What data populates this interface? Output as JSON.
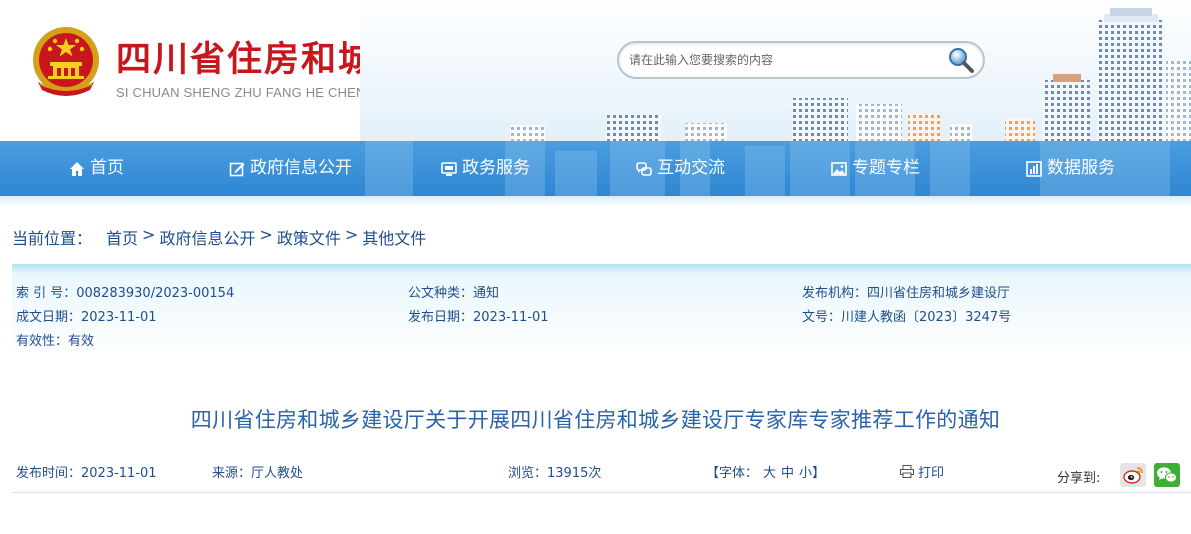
{
  "header": {
    "title": "四川省住房和城乡建设厅",
    "subtitle": "SI CHUAN SHENG ZHU FANG HE CHENG XIANG JIAN SHE TING",
    "emblem_icon": "national-emblem-icon"
  },
  "search": {
    "placeholder": "请在此输入您要搜索的内容",
    "value": "",
    "icon": "search-icon"
  },
  "nav": {
    "items": [
      {
        "label": "首页",
        "icon": "home-icon"
      },
      {
        "label": "政府信息公开",
        "icon": "edit-icon"
      },
      {
        "label": "政务服务",
        "icon": "monitor-icon"
      },
      {
        "label": "互动交流",
        "icon": "chat-icon"
      },
      {
        "label": "专题专栏",
        "icon": "image-icon"
      },
      {
        "label": "数据服务",
        "icon": "chart-icon"
      }
    ]
  },
  "breadcrumb": {
    "label": "当前位置：",
    "items": [
      "首页",
      "政府信息公开",
      "政策文件",
      "其他文件"
    ],
    "separator": ">"
  },
  "info": {
    "index_key": "索 引 号：",
    "index_value": "008283930/2023-00154",
    "doc_type_key": "公文种类：",
    "doc_type_value": "通知",
    "issuer_key": "发布机构：",
    "issuer_value": "四川省住房和城乡建设厅",
    "created_key": "成文日期：",
    "created_value": "2023-11-01",
    "published_key": "发布日期：",
    "published_value": "2023-11-01",
    "doc_no_key": "文号：",
    "doc_no_value": "川建人教函〔2023〕3247号",
    "validity_key": "有效性：",
    "validity_value": "有效"
  },
  "article": {
    "title": "四川省住房和城乡建设厅关于开展四川省住房和城乡建设厅专家库专家推荐工作的通知",
    "publish_time_key": "发布时间：",
    "publish_time_value": "2023-11-01",
    "source_key": "来源：",
    "source_value": "厅人教处",
    "views_key": "浏览：",
    "views_value": "13915次",
    "font_label": "【字体：",
    "font_large": "大",
    "font_medium": "中",
    "font_small": "小",
    "font_end": "】",
    "print_label": "打印",
    "share_label": "分享到:",
    "share_icons": [
      "weibo-icon",
      "wechat-icon"
    ]
  },
  "colors": {
    "title_red": "#c8161d",
    "nav_blue": "#2f86d2",
    "link_blue": "#1f4e8c",
    "article_title_blue": "#2a63a8",
    "weibo_bg": "#e5e5e5",
    "wechat_green": "#3cb034"
  }
}
